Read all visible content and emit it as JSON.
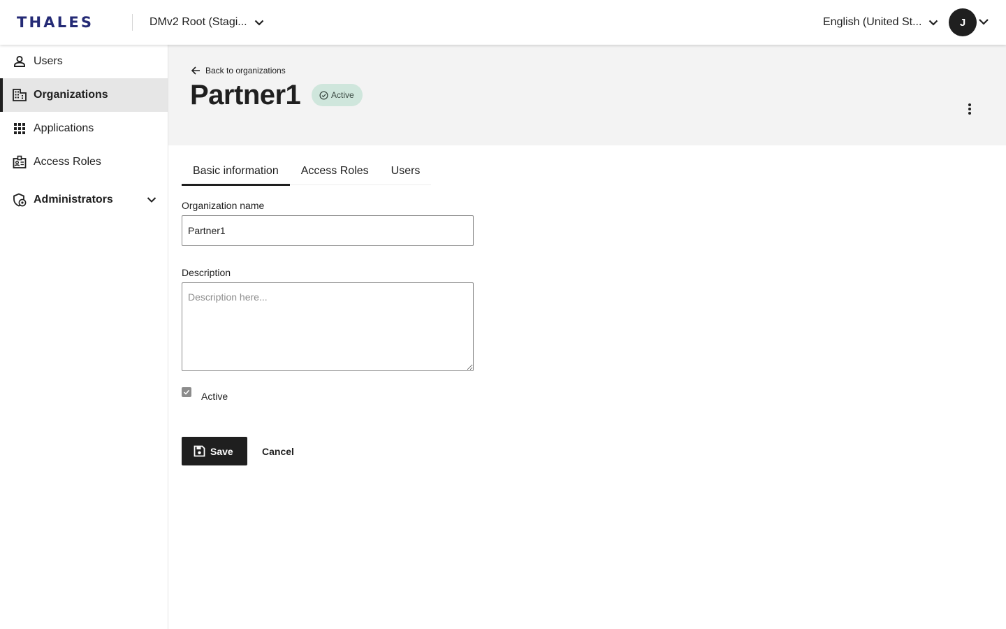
{
  "topbar": {
    "logo": "THALES",
    "tenant": "DMv2 Root (Stagi...",
    "language": "English (United St...",
    "avatar_initial": "J"
  },
  "sidebar": {
    "items": [
      {
        "label": "Users",
        "icon": "person-icon",
        "active": false
      },
      {
        "label": "Organizations",
        "icon": "building-icon",
        "active": true
      },
      {
        "label": "Applications",
        "icon": "grid-icon",
        "active": false
      },
      {
        "label": "Access Roles",
        "icon": "id-badge-icon",
        "active": false
      }
    ],
    "group": {
      "label": "Administrators",
      "icon": "shield-settings-icon"
    }
  },
  "header": {
    "back_label": "Back to organizations",
    "title": "Partner1",
    "status": "Active"
  },
  "tabs": [
    {
      "label": "Basic information",
      "active": true
    },
    {
      "label": "Access Roles",
      "active": false
    },
    {
      "label": "Users",
      "active": false
    }
  ],
  "form": {
    "org_name_label": "Organization name",
    "org_name_value": "Partner1",
    "description_label": "Description",
    "description_placeholder": "Description here...",
    "active_label": "Active",
    "active_checked": true,
    "save_label": "Save",
    "cancel_label": "Cancel"
  },
  "colors": {
    "brand": "#242a75",
    "badge_bg": "#cfe6dc",
    "primary_button": "#1f1f1f"
  }
}
